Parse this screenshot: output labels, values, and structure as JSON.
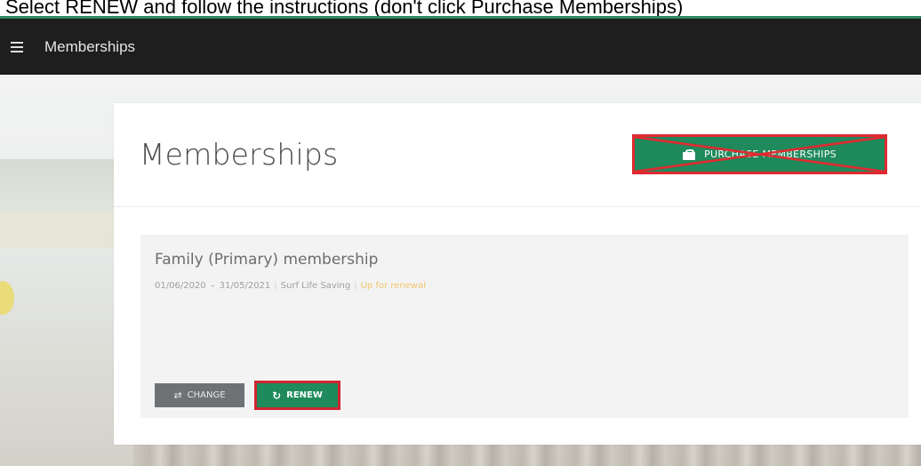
{
  "instruction": "Select RENEW and follow the instructions (don't click Purchase Memberships)",
  "navbar": {
    "title": "Memberships",
    "menu_icon": "hamburger-icon"
  },
  "page": {
    "title": "Memberships",
    "purchase_button": {
      "label": "PURCHASE MEMBERSHIPS",
      "icon": "bag-icon",
      "crossed_out": true
    }
  },
  "membership": {
    "title": "Family (Primary) membership",
    "start_date": "01/06/2020",
    "end_date": "31/05/2021",
    "organisation": "Surf Life Saving",
    "status": "Up for renewal",
    "change_label": "CHANGE",
    "renew_label": "RENEW"
  },
  "colors": {
    "accent": "#1f8a5c",
    "highlight": "#e02a30",
    "status": "#f0c56a",
    "navbar": "#1e1e1e"
  }
}
